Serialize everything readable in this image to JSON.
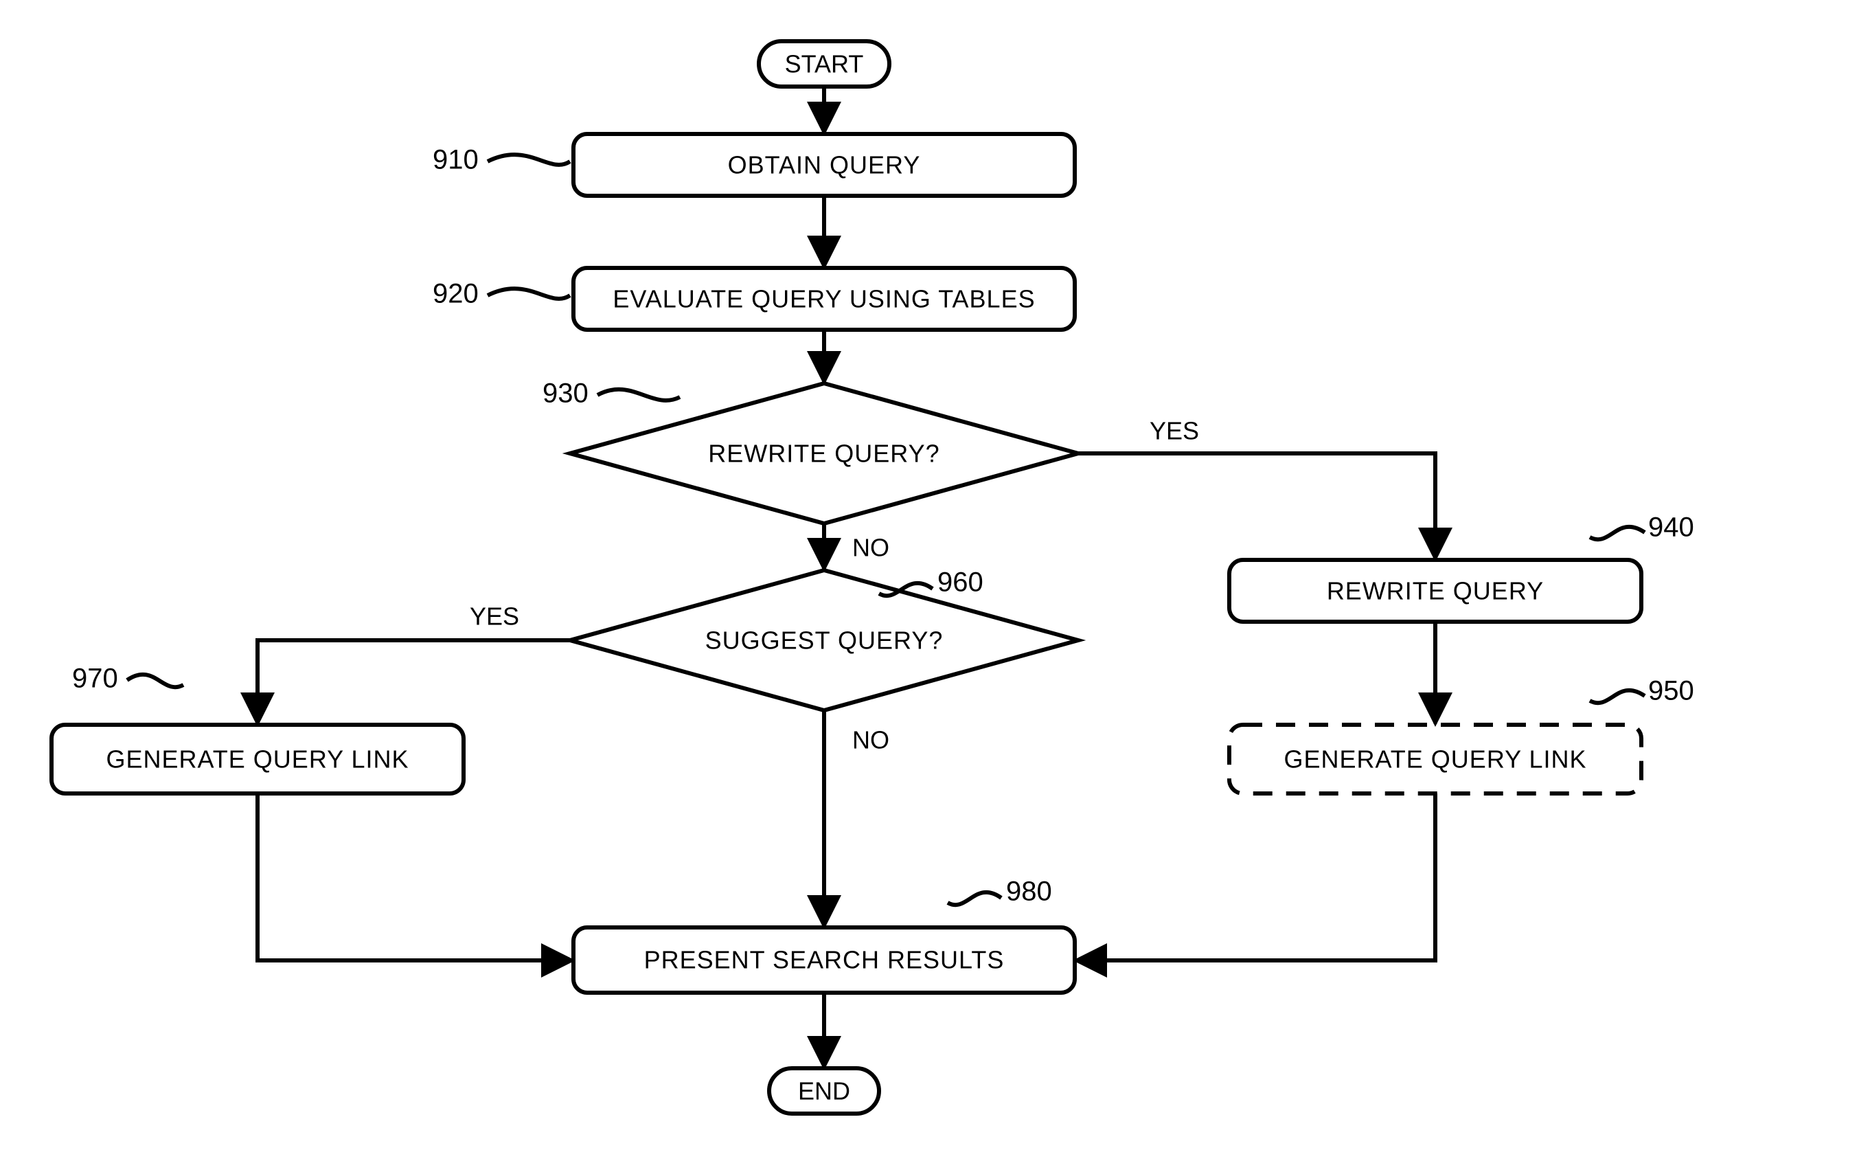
{
  "terminal": {
    "start": "START",
    "end": "END"
  },
  "boxes": {
    "obtain": "OBTAIN QUERY",
    "evaluate": "EVALUATE QUERY USING TABLES",
    "rewrite": "REWRITE QUERY",
    "genlinkR": "GENERATE QUERY LINK",
    "genlinkL": "GENERATE QUERY LINK",
    "present": "PRESENT SEARCH RESULTS"
  },
  "decisions": {
    "rewriteq": "REWRITE QUERY?",
    "suggestq": "SUGGEST QUERY?"
  },
  "refs": {
    "r910": "910",
    "r920": "920",
    "r930": "930",
    "r940": "940",
    "r950": "950",
    "r960": "960",
    "r970": "970",
    "r980": "980"
  },
  "edges": {
    "yes": "YES",
    "no": "NO"
  }
}
